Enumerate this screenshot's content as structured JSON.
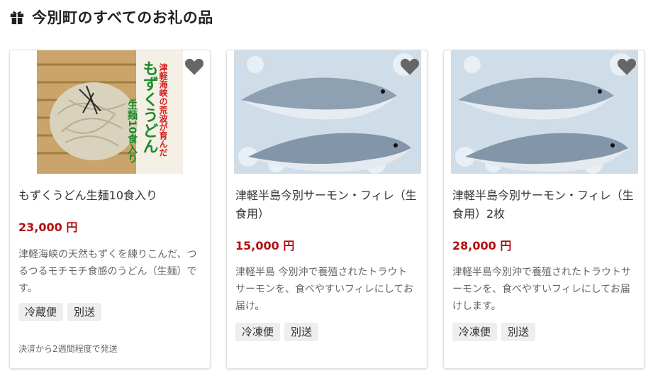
{
  "header": {
    "title": "今別町のすべてのお礼の品",
    "icon": "gift-icon"
  },
  "products": [
    {
      "image_icon": "udon-photo",
      "image_text": "津軽海峡の荒波が育んだ もずくうどん 生麺10食入り",
      "name": "もずくうどん生麺10食入り",
      "price": "23,000 円",
      "description": "津軽海峡の天然もずくを練りこんだ、つるつるモチモチ食感のうどん（生麺）です。",
      "tags": [
        "冷蔵便",
        "別送"
      ],
      "shipping": "決済から2週間程度で発送"
    },
    {
      "image_icon": "salmon-photo",
      "name": "津軽半島今別サーモン・フィレ（生食用）",
      "price": "15,000 円",
      "description": "津軽半島 今別沖で養殖されたトラウトサーモンを、食べやすいフィレにしてお届け。",
      "tags": [
        "冷凍便",
        "別送"
      ]
    },
    {
      "image_icon": "salmon-photo",
      "name": "津軽半島今別サーモン・フィレ（生食用）2枚",
      "price": "28,000 円",
      "description": "津軽半島今別沖で養殖されたトラウトサーモンを、食べやすいフィレにしてお届けします。",
      "tags": [
        "冷凍便",
        "別送"
      ]
    }
  ],
  "colors": {
    "price": "#b01010",
    "favorite_icon": "#666666"
  }
}
